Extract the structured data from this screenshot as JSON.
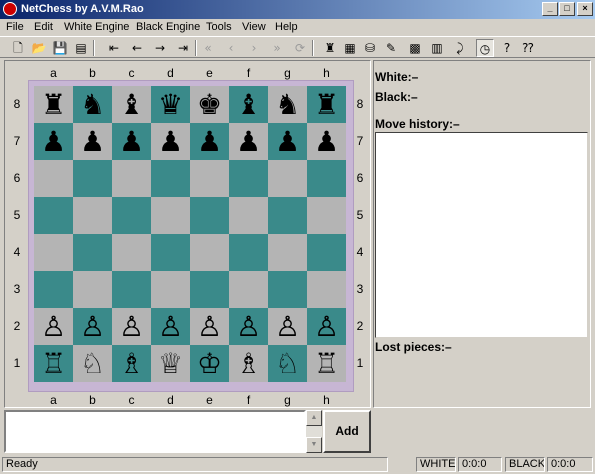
{
  "window": {
    "title": "NetChess by A.V.M.Rao"
  },
  "title_buttons": [
    "_",
    "□",
    "×"
  ],
  "menu": [
    "File",
    "Edit",
    "White Engine",
    "Black Engine",
    "Tools",
    "View",
    "Help"
  ],
  "toolbar": [
    {
      "name": "new-game-icon",
      "glyph": "🗋",
      "disabled": false
    },
    {
      "name": "open-icon",
      "glyph": "📂",
      "disabled": false
    },
    {
      "name": "save-icon",
      "glyph": "💾",
      "disabled": false
    },
    {
      "name": "print-icon",
      "glyph": "▤",
      "disabled": false
    },
    {
      "sep": true
    },
    {
      "name": "first-move-icon",
      "glyph": "⇤",
      "disabled": false
    },
    {
      "name": "prev-move-icon",
      "glyph": "←",
      "disabled": false
    },
    {
      "name": "next-move-icon",
      "glyph": "→",
      "disabled": false
    },
    {
      "name": "last-move-icon",
      "glyph": "⇥",
      "disabled": false
    },
    {
      "sep": true
    },
    {
      "name": "rewind-all-icon",
      "glyph": "«",
      "disabled": true
    },
    {
      "name": "rewind-icon",
      "glyph": "‹",
      "disabled": true
    },
    {
      "name": "forward-icon",
      "glyph": "›",
      "disabled": true
    },
    {
      "name": "forward-all-icon",
      "glyph": "»",
      "disabled": true
    },
    {
      "name": "refresh-icon",
      "glyph": "⟳",
      "disabled": true
    },
    {
      "sep": true
    },
    {
      "name": "engine-icon",
      "glyph": "♜",
      "disabled": false
    },
    {
      "name": "colors-icon",
      "glyph": "▦",
      "disabled": false
    },
    {
      "name": "network-icon",
      "glyph": "⛁",
      "disabled": false
    },
    {
      "name": "edit-position-icon",
      "glyph": "✎",
      "disabled": false
    },
    {
      "name": "board-icon",
      "glyph": "▩",
      "disabled": false
    },
    {
      "name": "notes-icon",
      "glyph": "▥",
      "disabled": false
    },
    {
      "name": "flip-icon",
      "glyph": "⤸",
      "disabled": false
    },
    {
      "name": "clock-icon",
      "glyph": "◷",
      "disabled": false,
      "pressed": true
    },
    {
      "name": "hint-icon",
      "glyph": "?",
      "disabled": false
    },
    {
      "name": "help-context-icon",
      "glyph": "⁇",
      "disabled": false
    }
  ],
  "board": {
    "files": [
      "a",
      "b",
      "c",
      "d",
      "e",
      "f",
      "g",
      "h"
    ],
    "ranks": [
      "8",
      "7",
      "6",
      "5",
      "4",
      "3",
      "2",
      "1"
    ],
    "rows": [
      [
        "♜",
        "♞",
        "♝",
        "♛",
        "♚",
        "♝",
        "♞",
        "♜"
      ],
      [
        "♟",
        "♟",
        "♟",
        "♟",
        "♟",
        "♟",
        "♟",
        "♟"
      ],
      [
        "",
        "",
        "",
        "",
        "",
        "",
        "",
        ""
      ],
      [
        "",
        "",
        "",
        "",
        "",
        "",
        "",
        ""
      ],
      [
        "",
        "",
        "",
        "",
        "",
        "",
        "",
        ""
      ],
      [
        "",
        "",
        "",
        "",
        "",
        "",
        "",
        ""
      ],
      [
        "♙",
        "♙",
        "♙",
        "♙",
        "♙",
        "♙",
        "♙",
        "♙"
      ],
      [
        "♖",
        "♘",
        "♗",
        "♕",
        "♔",
        "♗",
        "♘",
        "♖"
      ]
    ],
    "light_color": "#b4b4b4",
    "dark_color": "#3a8a8a",
    "border_color": "#c7b6d4"
  },
  "info": {
    "white_label": "White:–",
    "black_label": "Black:–",
    "history_label": "Move history:–",
    "lost_label": "Lost pieces:–"
  },
  "input": {
    "value": "",
    "add_label": "Add"
  },
  "status": {
    "text": "Ready",
    "white_label": "WHITE",
    "white_time": "0:0:0",
    "black_label": "BLACK",
    "black_time": "0:0:0"
  },
  "colors": {
    "titlebar_start": "#0a246a",
    "titlebar_end": "#a6caf0",
    "face": "#d4d0c8"
  }
}
